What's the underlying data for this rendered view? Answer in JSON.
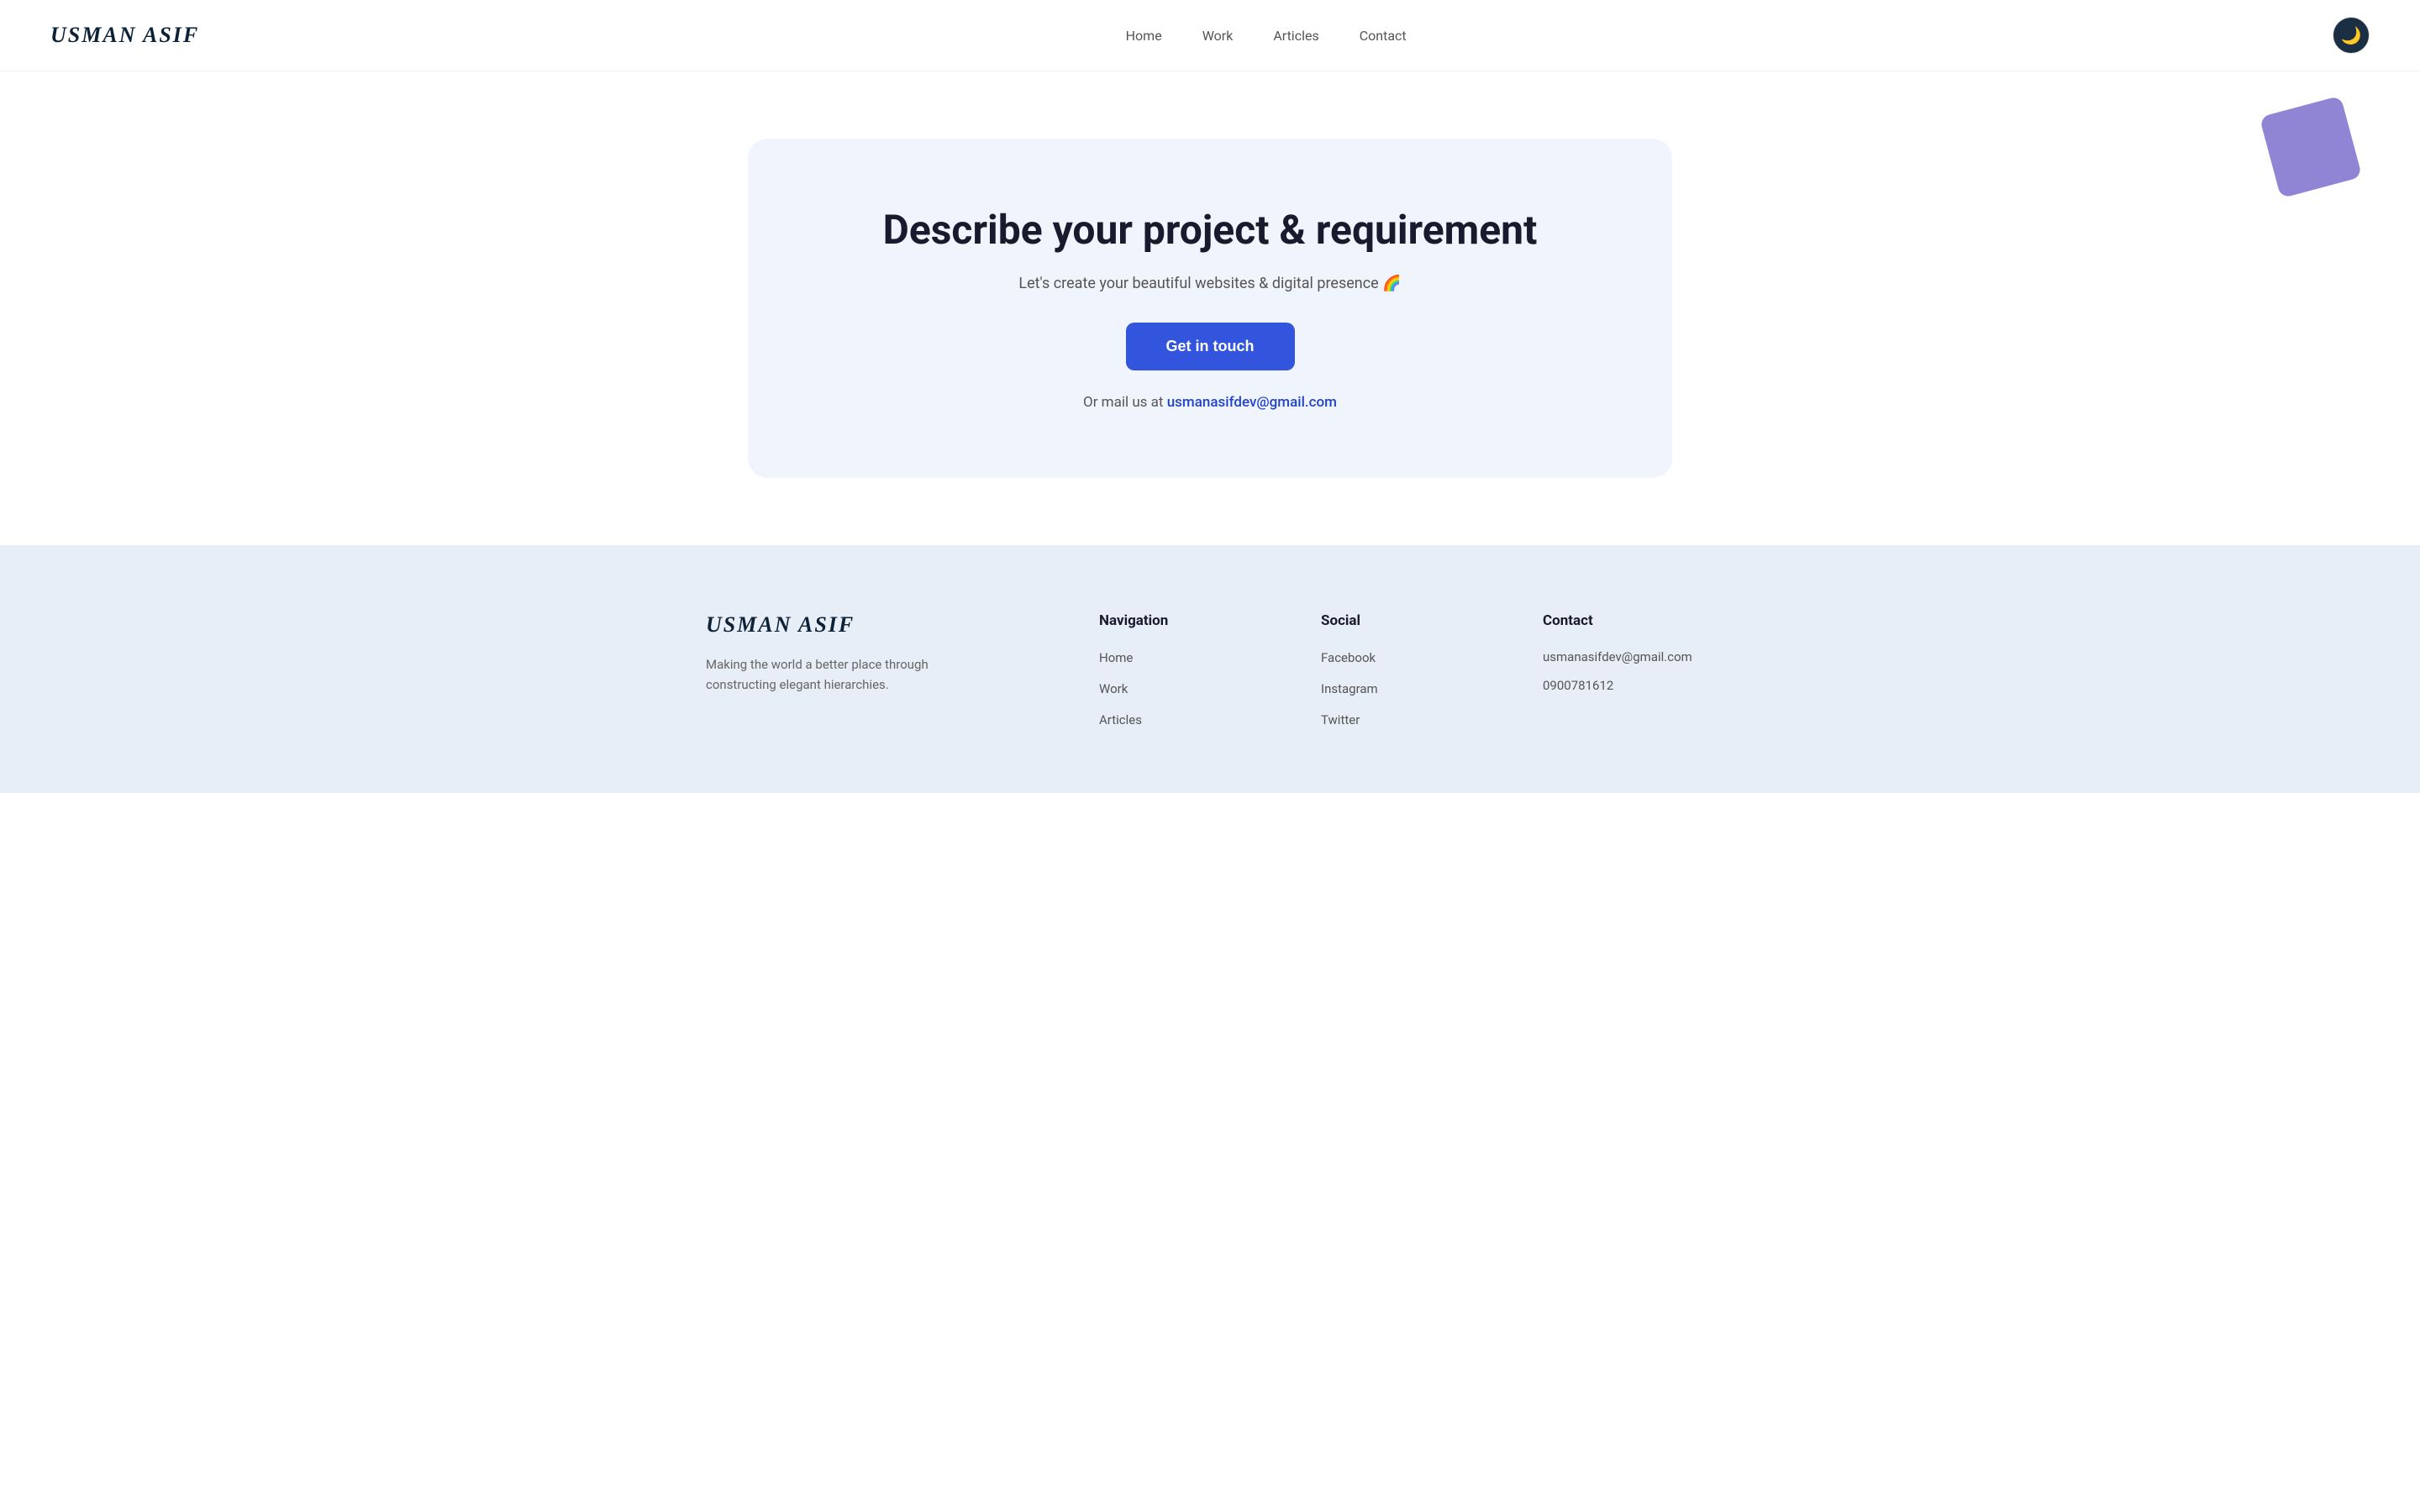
{
  "header": {
    "logo": "Usman Asif",
    "nav": {
      "home": "Home",
      "work": "Work",
      "articles": "Articles",
      "contact": "Contact"
    },
    "dark_mode_icon": "🌙"
  },
  "main": {
    "heading": "Describe your project & requirement",
    "subheading": "Let's create your beautiful websites & digital presence 🌈",
    "cta_button": "Get in touch",
    "mail_prefix": "Or mail us at",
    "email": "usmanasifdev@gmail.com"
  },
  "footer": {
    "logo": "Usman Asif",
    "tagline": "Making the world a better place through constructing elegant hierarchies.",
    "navigation": {
      "heading": "Navigation",
      "items": [
        {
          "label": "Home"
        },
        {
          "label": "Work"
        },
        {
          "label": "Articles"
        }
      ]
    },
    "social": {
      "heading": "Social",
      "items": [
        {
          "label": "Facebook"
        },
        {
          "label": "Instagram"
        },
        {
          "label": "Twitter"
        }
      ]
    },
    "contact": {
      "heading": "Contact",
      "email": "usmanasifdev@gmail.com",
      "phone": "0900781612"
    }
  }
}
